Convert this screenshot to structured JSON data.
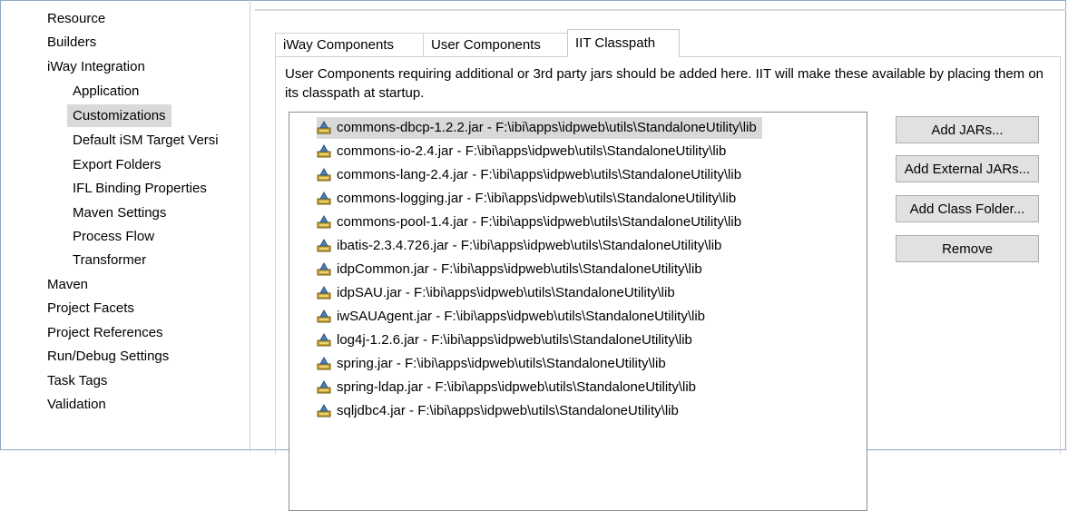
{
  "nav": {
    "items": [
      {
        "label": "Resource"
      },
      {
        "label": "Builders"
      },
      {
        "label": "iWay Integration"
      },
      {
        "label": "Application"
      },
      {
        "label": "Customizations"
      },
      {
        "label": "Default iSM Target Versi"
      },
      {
        "label": "Export Folders"
      },
      {
        "label": "IFL Binding Properties"
      },
      {
        "label": "Maven Settings"
      },
      {
        "label": "Process Flow"
      },
      {
        "label": "Transformer"
      },
      {
        "label": "Maven"
      },
      {
        "label": "Project Facets"
      },
      {
        "label": "Project References"
      },
      {
        "label": "Run/Debug Settings"
      },
      {
        "label": "Task Tags"
      },
      {
        "label": "Validation"
      }
    ],
    "selected_index": 4
  },
  "tabs": [
    {
      "label": "iWay Components"
    },
    {
      "label": "User Components"
    },
    {
      "label": "IIT Classpath"
    }
  ],
  "active_tab_index": 2,
  "description": "User Components requiring additional or 3rd party jars should be added here. IIT will make these available by placing them on its classpath at startup.",
  "jars": [
    {
      "label": "commons-dbcp-1.2.2.jar - F:\\ibi\\apps\\idpweb\\utils\\StandaloneUtility\\lib"
    },
    {
      "label": "commons-io-2.4.jar - F:\\ibi\\apps\\idpweb\\utils\\StandaloneUtility\\lib"
    },
    {
      "label": "commons-lang-2.4.jar - F:\\ibi\\apps\\idpweb\\utils\\StandaloneUtility\\lib"
    },
    {
      "label": "commons-logging.jar - F:\\ibi\\apps\\idpweb\\utils\\StandaloneUtility\\lib"
    },
    {
      "label": "commons-pool-1.4.jar - F:\\ibi\\apps\\idpweb\\utils\\StandaloneUtility\\lib"
    },
    {
      "label": "ibatis-2.3.4.726.jar - F:\\ibi\\apps\\idpweb\\utils\\StandaloneUtility\\lib"
    },
    {
      "label": "idpCommon.jar - F:\\ibi\\apps\\idpweb\\utils\\StandaloneUtility\\lib"
    },
    {
      "label": "idpSAU.jar - F:\\ibi\\apps\\idpweb\\utils\\StandaloneUtility\\lib"
    },
    {
      "label": "iwSAUAgent.jar - F:\\ibi\\apps\\idpweb\\utils\\StandaloneUtility\\lib"
    },
    {
      "label": "log4j-1.2.6.jar - F:\\ibi\\apps\\idpweb\\utils\\StandaloneUtility\\lib"
    },
    {
      "label": "spring.jar - F:\\ibi\\apps\\idpweb\\utils\\StandaloneUtility\\lib"
    },
    {
      "label": "spring-ldap.jar - F:\\ibi\\apps\\idpweb\\utils\\StandaloneUtility\\lib"
    },
    {
      "label": "sqljdbc4.jar - F:\\ibi\\apps\\idpweb\\utils\\StandaloneUtility\\lib"
    }
  ],
  "selected_jar_index": 0,
  "buttons": {
    "add_jars": "Add JARs...",
    "add_external_jars": "Add External JARs...",
    "add_class_folder": "Add Class Folder...",
    "remove": "Remove"
  },
  "icons": {
    "jar": "jar-file-icon"
  },
  "colors": {
    "selection": "#d9d9d9",
    "frame_border": "#8fa9c9",
    "button_face": "#e1e1e1"
  }
}
